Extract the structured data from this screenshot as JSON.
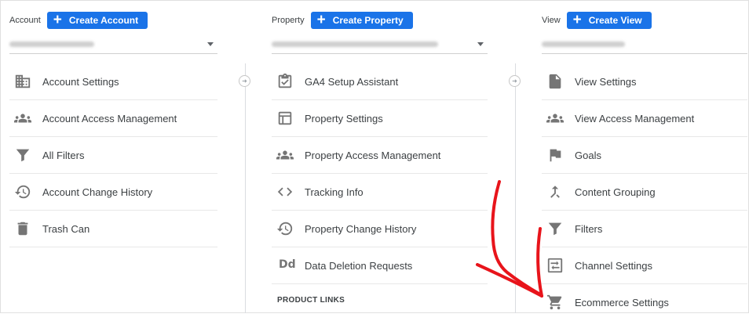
{
  "columns": {
    "account": {
      "label": "Account",
      "create_label": "Create Account",
      "items": [
        {
          "label": "Account Settings",
          "icon": "building-icon"
        },
        {
          "label": "Account Access Management",
          "icon": "people-icon"
        },
        {
          "label": "All Filters",
          "icon": "filter-icon"
        },
        {
          "label": "Account Change History",
          "icon": "history-icon"
        },
        {
          "label": "Trash Can",
          "icon": "trash-icon"
        }
      ]
    },
    "property": {
      "label": "Property",
      "create_label": "Create Property",
      "items": [
        {
          "label": "GA4 Setup Assistant",
          "icon": "checklist-icon"
        },
        {
          "label": "Property Settings",
          "icon": "layout-icon"
        },
        {
          "label": "Property Access Management",
          "icon": "people-icon"
        },
        {
          "label": "Tracking Info",
          "icon": "code-icon"
        },
        {
          "label": "Property Change History",
          "icon": "history-icon"
        },
        {
          "label": "Data Deletion Requests",
          "icon": "dd-icon",
          "glyph": "Dd"
        }
      ],
      "section_heading": "PRODUCT LINKS"
    },
    "view": {
      "label": "View",
      "create_label": "Create View",
      "items": [
        {
          "label": "View Settings",
          "icon": "document-icon"
        },
        {
          "label": "View Access Management",
          "icon": "people-icon"
        },
        {
          "label": "Goals",
          "icon": "flag-icon"
        },
        {
          "label": "Content Grouping",
          "icon": "merge-icon"
        },
        {
          "label": "Filters",
          "icon": "filter-icon"
        },
        {
          "label": "Channel Settings",
          "icon": "channel-icon"
        },
        {
          "label": "Ecommerce Settings",
          "icon": "cart-icon"
        }
      ]
    }
  },
  "colors": {
    "primary_button": "#1a73e8",
    "icon_gray": "#757575",
    "annotation_arrow": "#e8141b"
  }
}
